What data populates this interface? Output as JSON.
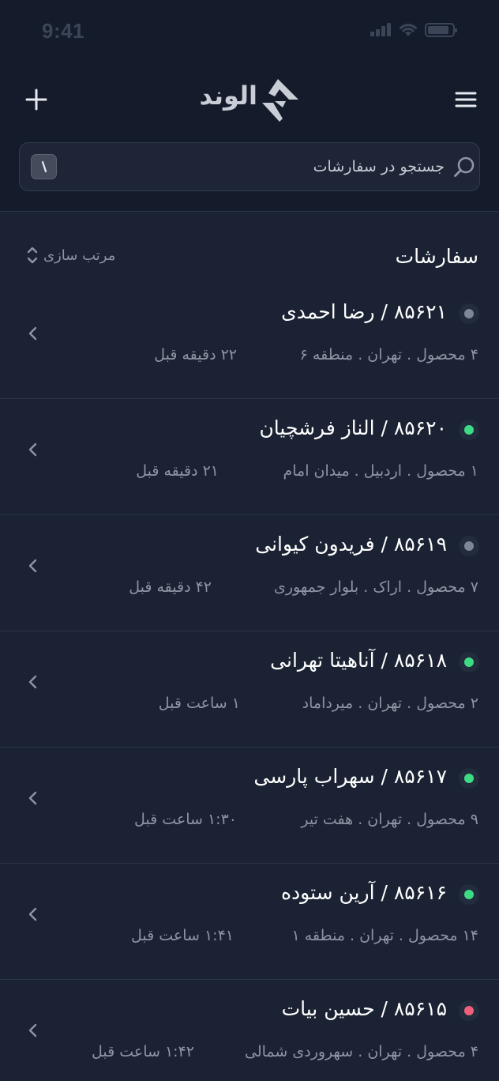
{
  "status_bar": {
    "time": "9:41"
  },
  "header": {
    "logo_text": "الوند"
  },
  "search": {
    "placeholder": "جستجو در سفارشات",
    "value": ""
  },
  "section": {
    "title": "سفارشات",
    "sort_label": "مرتب سازی"
  },
  "colors": {
    "online": "#3ddc84",
    "offline": "#7f8696",
    "cancelled": "#f0607a"
  },
  "orders": [
    {
      "title": "۸۵۶۲۱ / رضا احمدی",
      "meta": "۴ محصول . تهران . منطقه ۶",
      "time": "۲۲ دقیقه قبل",
      "status": "offline",
      "status_color": "#7f8696"
    },
    {
      "title": "۸۵۶۲۰ / الناز فرشچیان",
      "meta": "۱ محصول . اردبیل . میدان امام",
      "time": "۲۱ دقیقه قبل",
      "status": "online",
      "status_color": "#3ddc84"
    },
    {
      "title": "۸۵۶۱۹ / فریدون کیوانی",
      "meta": "۷ محصول . اراک . بلوار جمهوری",
      "time": "۴۲ دقیقه قبل",
      "status": "offline",
      "status_color": "#7f8696"
    },
    {
      "title": "۸۵۶۱۸ / آناهیتا تهرانی",
      "meta": "۲ محصول . تهران . میرداماد",
      "time": "۱ ساعت قبل",
      "status": "online",
      "status_color": "#3ddc84"
    },
    {
      "title": "۸۵۶۱۷ / سهراب پارسی",
      "meta": "۹ محصول . تهران . هفت تیر",
      "time": "۱:۳۰ ساعت قبل",
      "status": "online",
      "status_color": "#3ddc84"
    },
    {
      "title": "۸۵۶۱۶ / آرین ستوده",
      "meta": "۱۴ محصول . تهران . منطقه ۱",
      "time": "۱:۴۱ ساعت قبل",
      "status": "online",
      "status_color": "#3ddc84"
    },
    {
      "title": "۸۵۶۱۵ / حسین بیات",
      "meta": "۴ محصول . تهران . سهروردی شمالی",
      "time": "۱:۴۲ ساعت قبل",
      "status": "cancelled",
      "status_color": "#f0607a"
    }
  ]
}
